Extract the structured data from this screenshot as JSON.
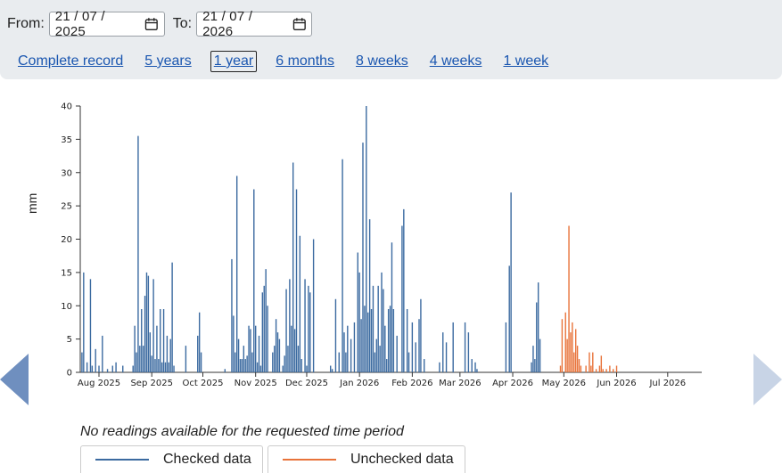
{
  "filters": {
    "from_label": "From:",
    "from_value": "21 / 07 / 2025",
    "to_label": "To:",
    "to_value": "21 / 07 / 2026"
  },
  "ranges": [
    {
      "label": "Complete record",
      "selected": false
    },
    {
      "label": "5 years",
      "selected": false
    },
    {
      "label": "1 year",
      "selected": true
    },
    {
      "label": "6 months",
      "selected": false
    },
    {
      "label": "8 weeks",
      "selected": false
    },
    {
      "label": "4 weeks",
      "selected": false
    },
    {
      "label": "1 week",
      "selected": false
    }
  ],
  "message": "No readings available for the requested time period",
  "legend": {
    "checked": "Checked data",
    "unchecked": "Unchecked data"
  },
  "nav": {
    "prev_icon": "chevron-left-icon",
    "next_icon": "chevron-right-icon"
  },
  "colors": {
    "checked": "#3b6aa0",
    "unchecked": "#e8733a",
    "link": "#1a56b0",
    "nav_prev": "#6f8fbf",
    "nav_next": "#c8d4e6"
  },
  "chart_data": {
    "type": "bar",
    "ylabel": "mm",
    "ylim": [
      0,
      40
    ],
    "yticks": [
      0,
      5,
      10,
      15,
      20,
      25,
      30,
      35,
      40
    ],
    "xlim": [
      "2025-07-21",
      "2026-07-21"
    ],
    "xticks": [
      {
        "date": "2025-08-01",
        "label": "Aug 2025"
      },
      {
        "date": "2025-09-01",
        "label": "Sep 2025"
      },
      {
        "date": "2025-10-01",
        "label": "Oct 2025"
      },
      {
        "date": "2025-11-01",
        "label": "Nov 2025"
      },
      {
        "date": "2025-12-01",
        "label": "Dec 2025"
      },
      {
        "date": "2026-01-01",
        "label": "Jan 2026"
      },
      {
        "date": "2026-02-01",
        "label": "Feb 2026"
      },
      {
        "date": "2026-03-01",
        "label": "Mar 2026"
      },
      {
        "date": "2026-04-01",
        "label": "Apr 2026"
      },
      {
        "date": "2026-05-01",
        "label": "May 2026"
      },
      {
        "date": "2026-06-01",
        "label": "Jun 2026"
      },
      {
        "date": "2026-07-01",
        "label": "Jul 2026"
      }
    ],
    "grid": false,
    "series": [
      {
        "name": "Checked data",
        "points": [
          [
            "2025-07-22",
            3.0
          ],
          [
            "2025-07-23",
            15.0
          ],
          [
            "2025-07-25",
            1.5
          ],
          [
            "2025-07-27",
            14.0
          ],
          [
            "2025-07-28",
            1.0
          ],
          [
            "2025-07-30",
            3.5
          ],
          [
            "2025-08-01",
            1.0
          ],
          [
            "2025-08-03",
            5.5
          ],
          [
            "2025-08-06",
            0.5
          ],
          [
            "2025-08-09",
            1.0
          ],
          [
            "2025-08-11",
            1.5
          ],
          [
            "2025-08-15",
            1.0
          ],
          [
            "2025-08-21",
            1.0
          ],
          [
            "2025-08-22",
            7.0
          ],
          [
            "2025-08-23",
            3.0
          ],
          [
            "2025-08-24",
            35.5
          ],
          [
            "2025-08-25",
            4.0
          ],
          [
            "2025-08-26",
            9.5
          ],
          [
            "2025-08-27",
            4.0
          ],
          [
            "2025-08-28",
            11.5
          ],
          [
            "2025-08-29",
            15.0
          ],
          [
            "2025-08-30",
            14.5
          ],
          [
            "2025-08-31",
            6.0
          ],
          [
            "2025-09-01",
            2.5
          ],
          [
            "2025-09-02",
            14.0
          ],
          [
            "2025-09-03",
            2.0
          ],
          [
            "2025-09-04",
            7.0
          ],
          [
            "2025-09-05",
            2.0
          ],
          [
            "2025-09-06",
            9.5
          ],
          [
            "2025-09-07",
            1.5
          ],
          [
            "2025-09-08",
            9.5
          ],
          [
            "2025-09-09",
            1.5
          ],
          [
            "2025-09-10",
            5.5
          ],
          [
            "2025-09-11",
            1.5
          ],
          [
            "2025-09-12",
            5.0
          ],
          [
            "2025-09-13",
            16.5
          ],
          [
            "2025-09-14",
            1.0
          ],
          [
            "2025-09-21",
            4.0
          ],
          [
            "2025-09-28",
            5.5
          ],
          [
            "2025-09-29",
            9.0
          ],
          [
            "2025-09-30",
            3.0
          ],
          [
            "2025-10-14",
            0.5
          ],
          [
            "2025-10-18",
            17.0
          ],
          [
            "2025-10-19",
            8.5
          ],
          [
            "2025-10-20",
            3.0
          ],
          [
            "2025-10-21",
            29.5
          ],
          [
            "2025-10-22",
            5.0
          ],
          [
            "2025-10-23",
            2.0
          ],
          [
            "2025-10-24",
            2.0
          ],
          [
            "2025-10-25",
            4.0
          ],
          [
            "2025-10-26",
            2.0
          ],
          [
            "2025-10-27",
            2.5
          ],
          [
            "2025-10-28",
            7.0
          ],
          [
            "2025-10-29",
            6.5
          ],
          [
            "2025-10-30",
            3.0
          ],
          [
            "2025-10-31",
            27.5
          ],
          [
            "2025-11-01",
            7.0
          ],
          [
            "2025-11-02",
            1.5
          ],
          [
            "2025-11-03",
            5.5
          ],
          [
            "2025-11-04",
            1.0
          ],
          [
            "2025-11-05",
            12.0
          ],
          [
            "2025-11-06",
            13.0
          ],
          [
            "2025-11-07",
            15.5
          ],
          [
            "2025-11-08",
            10.0
          ],
          [
            "2025-11-11",
            3.0
          ],
          [
            "2025-11-12",
            4.0
          ],
          [
            "2025-11-13",
            8.0
          ],
          [
            "2025-11-14",
            6.0
          ],
          [
            "2025-11-15",
            5.0
          ],
          [
            "2025-11-17",
            1.0
          ],
          [
            "2025-11-18",
            2.5
          ],
          [
            "2025-11-19",
            12.5
          ],
          [
            "2025-11-20",
            4.0
          ],
          [
            "2025-11-21",
            14.0
          ],
          [
            "2025-11-22",
            7.0
          ],
          [
            "2025-11-23",
            31.5
          ],
          [
            "2025-11-24",
            6.5
          ],
          [
            "2025-11-25",
            27.5
          ],
          [
            "2025-11-26",
            4.0
          ],
          [
            "2025-11-27",
            20.5
          ],
          [
            "2025-11-28",
            2.0
          ],
          [
            "2025-11-30",
            14.0
          ],
          [
            "2025-12-01",
            1.0
          ],
          [
            "2025-12-02",
            13.0
          ],
          [
            "2025-12-03",
            12.0
          ],
          [
            "2025-12-05",
            20.0
          ],
          [
            "2025-12-15",
            1.0
          ],
          [
            "2025-12-16",
            0.5
          ],
          [
            "2025-12-18",
            11.0
          ],
          [
            "2025-12-20",
            3.0
          ],
          [
            "2025-12-22",
            32.0
          ],
          [
            "2025-12-23",
            6.0
          ],
          [
            "2025-12-24",
            3.0
          ],
          [
            "2025-12-25",
            7.0
          ],
          [
            "2025-12-27",
            5.0
          ],
          [
            "2025-12-29",
            7.5
          ],
          [
            "2025-12-31",
            18.0
          ],
          [
            "2026-01-01",
            15.0
          ],
          [
            "2026-01-02",
            8.0
          ],
          [
            "2026-01-03",
            34.5
          ],
          [
            "2026-01-04",
            10.0
          ],
          [
            "2026-01-05",
            40.0
          ],
          [
            "2026-01-06",
            9.0
          ],
          [
            "2026-01-07",
            23.0
          ],
          [
            "2026-01-08",
            9.5
          ],
          [
            "2026-01-09",
            13.0
          ],
          [
            "2026-01-10",
            3.0
          ],
          [
            "2026-01-11",
            5.0
          ],
          [
            "2026-01-12",
            13.0
          ],
          [
            "2026-01-13",
            4.0
          ],
          [
            "2026-01-14",
            15.0
          ],
          [
            "2026-01-15",
            12.5
          ],
          [
            "2026-01-16",
            7.0
          ],
          [
            "2026-01-17",
            2.0
          ],
          [
            "2026-01-18",
            9.5
          ],
          [
            "2026-01-19",
            10.0
          ],
          [
            "2026-01-20",
            19.5
          ],
          [
            "2026-01-21",
            9.5
          ],
          [
            "2026-01-23",
            5.5
          ],
          [
            "2026-01-26",
            22.0
          ],
          [
            "2026-01-27",
            24.5
          ],
          [
            "2026-01-29",
            9.5
          ],
          [
            "2026-01-30",
            3.0
          ],
          [
            "2026-02-01",
            7.5
          ],
          [
            "2026-02-03",
            4.5
          ],
          [
            "2026-02-05",
            8.0
          ],
          [
            "2026-02-06",
            11.0
          ],
          [
            "2026-02-08",
            2.0
          ],
          [
            "2026-02-17",
            1.5
          ],
          [
            "2026-02-19",
            6.0
          ],
          [
            "2026-02-21",
            4.5
          ],
          [
            "2026-02-25",
            7.5
          ],
          [
            "2026-03-04",
            7.5
          ],
          [
            "2026-03-06",
            6.0
          ],
          [
            "2026-03-08",
            2.0
          ],
          [
            "2026-03-10",
            1.5
          ],
          [
            "2026-03-11",
            0.5
          ],
          [
            "2026-03-28",
            7.5
          ],
          [
            "2026-03-30",
            16.0
          ],
          [
            "2026-03-31",
            27.0
          ],
          [
            "2026-04-12",
            1.5
          ],
          [
            "2026-04-13",
            4.0
          ],
          [
            "2026-04-14",
            2.0
          ],
          [
            "2026-04-15",
            10.5
          ],
          [
            "2026-04-16",
            13.5
          ],
          [
            "2026-04-17",
            5.0
          ]
        ]
      },
      {
        "name": "Unchecked data",
        "points": [
          [
            "2026-04-29",
            1.0
          ],
          [
            "2026-04-30",
            8.0
          ],
          [
            "2026-05-02",
            9.0
          ],
          [
            "2026-05-03",
            5.0
          ],
          [
            "2026-05-04",
            22.0
          ],
          [
            "2026-05-05",
            6.0
          ],
          [
            "2026-05-06",
            7.5
          ],
          [
            "2026-05-07",
            3.0
          ],
          [
            "2026-05-08",
            6.5
          ],
          [
            "2026-05-09",
            4.0
          ],
          [
            "2026-05-10",
            2.0
          ],
          [
            "2026-05-11",
            1.0
          ],
          [
            "2026-05-14",
            1.0
          ],
          [
            "2026-05-16",
            3.0
          ],
          [
            "2026-05-17",
            1.0
          ],
          [
            "2026-05-18",
            3.0
          ],
          [
            "2026-05-20",
            0.5
          ],
          [
            "2026-05-22",
            1.0
          ],
          [
            "2026-05-23",
            2.5
          ],
          [
            "2026-05-24",
            0.5
          ],
          [
            "2026-05-26",
            0.5
          ],
          [
            "2026-05-28",
            1.0
          ],
          [
            "2026-05-30",
            0.5
          ],
          [
            "2026-06-01",
            1.0
          ]
        ]
      }
    ]
  }
}
